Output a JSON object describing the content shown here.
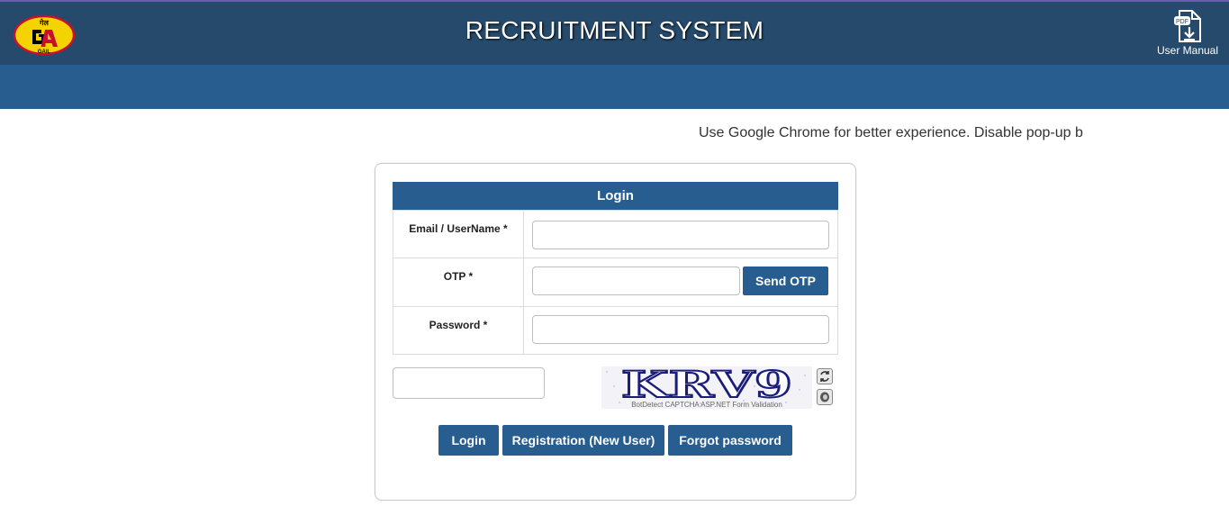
{
  "header": {
    "logo_text_top": "गेल",
    "logo_text_bottom": "GAIL",
    "title": "RECRUITMENT SYSTEM",
    "manual_icon_text": "PDF",
    "manual_label": "User Manual"
  },
  "notice": "Use Google Chrome for better experience. Disable pop-up b",
  "login": {
    "header": "Login",
    "fields": {
      "email_label": "Email / UserName *",
      "email_value": "",
      "otp_label": "OTP *",
      "otp_value": "",
      "password_label": "Password *",
      "password_value": ""
    },
    "send_otp_label": "Send OTP",
    "captcha": {
      "input_value": "",
      "code": "KRV9",
      "footer": "BotDetect CAPTCHA ASP.NET Form Validation",
      "reload_icon": "reload-icon",
      "audio_icon": "speaker-icon"
    },
    "buttons": {
      "login": "Login",
      "registration": "Registration (New User)",
      "forgot": "Forgot password"
    }
  },
  "colors": {
    "topbar": "#254a6c",
    "subbar": "#275d8f",
    "button": "#275d8f",
    "logo_yellow": "#f5d300",
    "logo_red": "#c8102e"
  }
}
